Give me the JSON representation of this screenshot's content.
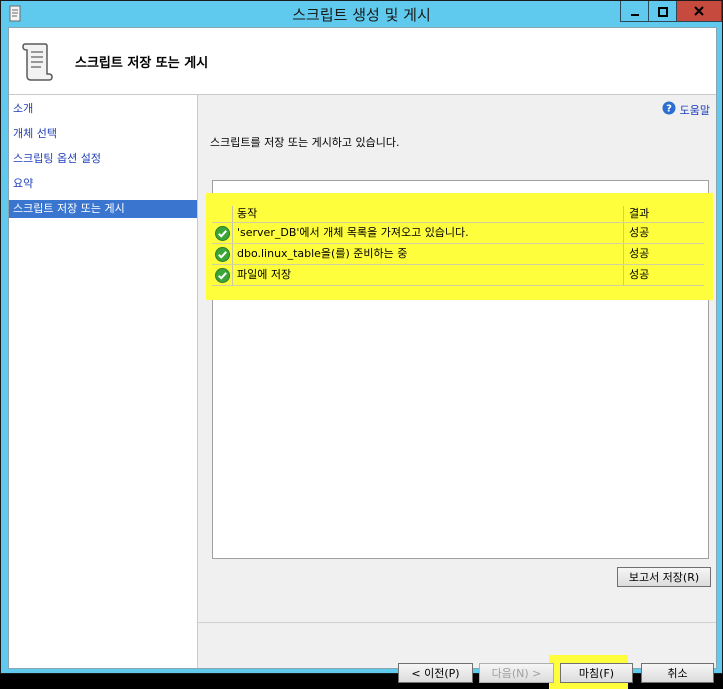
{
  "window": {
    "title": "스크립트 생성 및 게시"
  },
  "header": {
    "title": "스크립트 저장 또는 게시"
  },
  "sidebar": {
    "items": [
      {
        "label": "소개"
      },
      {
        "label": "개체 선택"
      },
      {
        "label": "스크립팅 옵션 설정"
      },
      {
        "label": "요약"
      },
      {
        "label": "스크립트 저장 또는 게시"
      }
    ]
  },
  "content": {
    "help_label": "도움말",
    "status_text": "스크립트를 저장 또는 게시하고 있습니다.",
    "table": {
      "headers": {
        "action": "동작",
        "result": "결과"
      },
      "rows": [
        {
          "action": "'server_DB'에서 개체 목록을 가져오고 있습니다.",
          "result": "성공"
        },
        {
          "action": "dbo.linux_table을(를) 준비하는 중",
          "result": "성공"
        },
        {
          "action": "파일에 저장",
          "result": "성공"
        }
      ]
    },
    "save_report_label": "보고서 저장(R)"
  },
  "footer": {
    "prev_label": "< 이전(P)",
    "next_label": "다음(N) >",
    "finish_label": "마침(F)",
    "cancel_label": "취소"
  },
  "colors": {
    "titlebar": "#5fcaed",
    "highlight": "#fefe3c",
    "active_item": "#3a76d0",
    "link": "#1f3fb8",
    "close_button": "#c74a3e"
  }
}
